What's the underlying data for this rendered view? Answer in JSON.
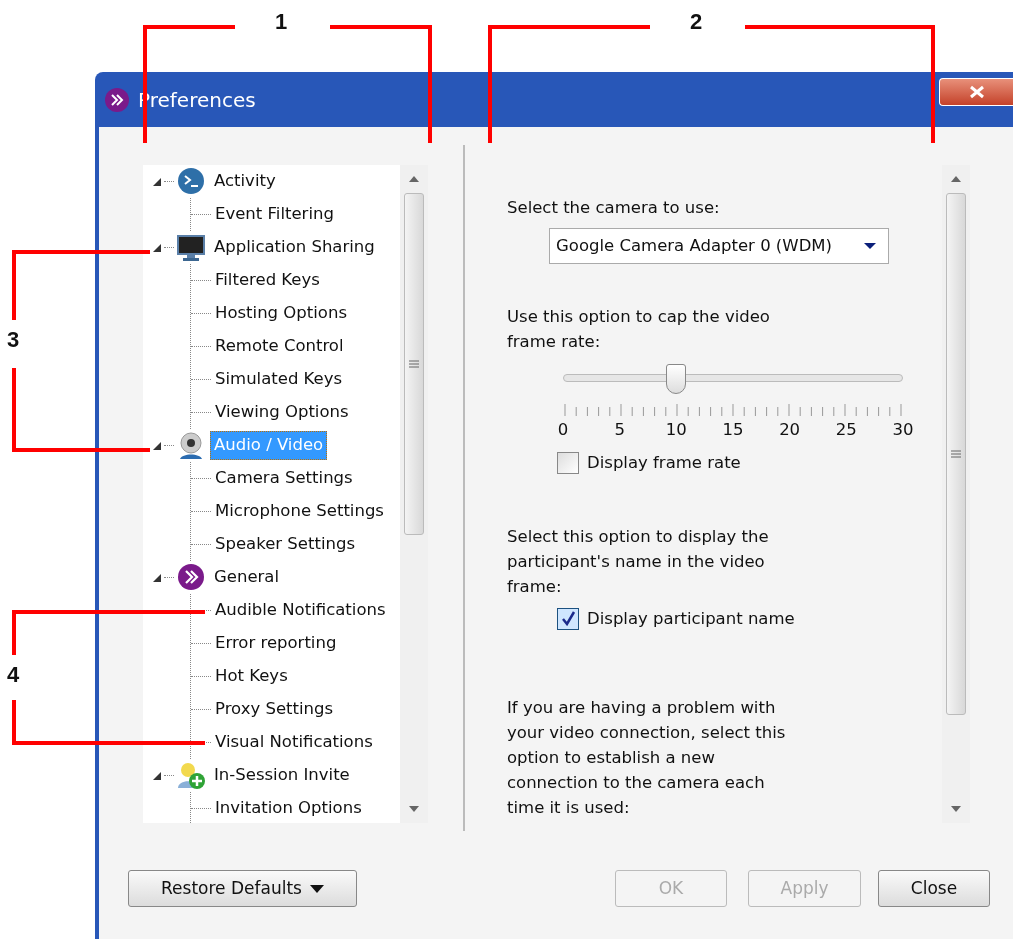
{
  "window": {
    "title": "Preferences"
  },
  "callouts": [
    {
      "label": "1"
    },
    {
      "label": "2"
    },
    {
      "label": "3"
    },
    {
      "label": "4"
    }
  ],
  "tree": {
    "items": [
      {
        "label": "Activity",
        "expanded": true,
        "selected": false,
        "children": [
          {
            "label": "Event Filtering",
            "selected": false
          }
        ]
      },
      {
        "label": "Application Sharing",
        "expanded": true,
        "selected": false,
        "children": [
          {
            "label": "Filtered Keys",
            "selected": false
          },
          {
            "label": "Hosting Options",
            "selected": false
          },
          {
            "label": "Remote Control",
            "selected": false
          },
          {
            "label": "Simulated Keys",
            "selected": false
          },
          {
            "label": "Viewing Options",
            "selected": false
          }
        ]
      },
      {
        "label": "Audio / Video",
        "expanded": true,
        "selected": true,
        "children": [
          {
            "label": "Camera Settings",
            "selected": false
          },
          {
            "label": "Microphone Settings",
            "selected": false
          },
          {
            "label": "Speaker Settings",
            "selected": false
          }
        ]
      },
      {
        "label": "General",
        "expanded": true,
        "selected": false,
        "children": [
          {
            "label": "Audible Notifications",
            "selected": false
          },
          {
            "label": "Error reporting",
            "selected": false
          },
          {
            "label": "Hot Keys",
            "selected": false
          },
          {
            "label": "Proxy Settings",
            "selected": false
          },
          {
            "label": "Visual Notifications",
            "selected": false
          }
        ]
      },
      {
        "label": "In-Session Invite",
        "expanded": true,
        "selected": false,
        "children": [
          {
            "label": "Invitation Options",
            "selected": false
          }
        ]
      }
    ]
  },
  "camera": {
    "label": "Select the camera to use:",
    "value": "Google Camera Adapter 0 (WDM)"
  },
  "frame_rate": {
    "label": "Use this option to cap the video frame rate:",
    "level": 0.333,
    "ticks": [
      "0",
      "5",
      "10",
      "15",
      "20",
      "25",
      "30"
    ],
    "checkbox": {
      "label": "Display frame rate",
      "checked": false
    }
  },
  "participant": {
    "label": "Select this option to display the participant's name in the video frame:",
    "checkbox": {
      "label": "Display participant name",
      "checked": true
    }
  },
  "reconnect": {
    "label": "If you are having a problem with your video connection, select this option to establish a new connection to the camera each time it is used:"
  },
  "buttons": [
    {
      "label": "Restore Defaults",
      "kind": "menu",
      "disabled": false
    },
    {
      "label": "OK",
      "kind": "push",
      "disabled": true
    },
    {
      "label": "Apply",
      "kind": "push",
      "disabled": true
    },
    {
      "label": "Close",
      "kind": "push",
      "disabled": false
    }
  ]
}
